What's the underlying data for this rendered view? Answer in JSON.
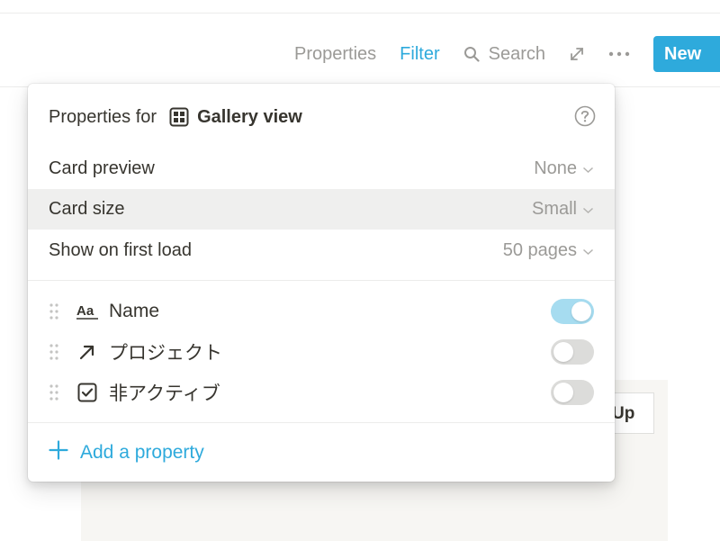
{
  "toolbar": {
    "properties_label": "Properties",
    "filter_label": "Filter",
    "search_label": "Search",
    "expand_icon": "expand-icon",
    "more_icon": "more-icon",
    "new_label": "New"
  },
  "background_card": {
    "label": "Up"
  },
  "panel": {
    "header_label": "Properties for",
    "view_icon": "gallery-view-icon",
    "view_name": "Gallery view",
    "help_icon": "help-icon",
    "options": [
      {
        "label": "Card preview",
        "value": "None"
      },
      {
        "label": "Card size",
        "value": "Small"
      },
      {
        "label": "Show on first load",
        "value": "50 pages"
      }
    ],
    "properties": [
      {
        "icon": "text-type-icon",
        "name": "Name",
        "visible": true
      },
      {
        "icon": "relation-arrow-icon",
        "name": "プロジェクト",
        "visible": false
      },
      {
        "icon": "checkbox-icon",
        "name": "非アクティブ",
        "visible": false
      }
    ],
    "add_property_label": "Add a property"
  },
  "colors": {
    "accent": "#2eaadc",
    "toggle_on": "#a6dcf0",
    "toggle_off": "#dcdcda",
    "muted_text": "#9b9a97",
    "text": "#37352f",
    "hover_row": "#efefee"
  }
}
